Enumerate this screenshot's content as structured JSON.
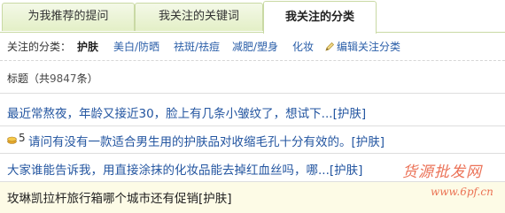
{
  "tabs": [
    {
      "label": "为我推荐的提问"
    },
    {
      "label": "我关注的关键词"
    },
    {
      "label": "我关注的分类"
    }
  ],
  "filter": {
    "label": "关注的分类：",
    "categories": [
      "护肤",
      "美白/防晒",
      "祛斑/祛痘",
      "减肥/塑身",
      "化妆"
    ],
    "active": "护肤",
    "edit_label": "编辑关注分类"
  },
  "summary": {
    "prefix": "标题（共",
    "count": "9847",
    "suffix": "条）"
  },
  "questions": [
    {
      "title": "最近常熬夜，年龄又接近30，脸上有几条小皱纹了，想试下...",
      "tag": "[护肤]"
    },
    {
      "points": "5",
      "title": "请问有没有一款适合男生用的护肤品对收缩毛孔十分有效的。",
      "tag": "[护肤]"
    },
    {
      "title": "大家谁能告诉我，用直接涂抹的化妆品能去掉红血丝吗，哪...",
      "tag": "[护肤]"
    },
    {
      "title": "玫琳凯拉杆旅行箱哪个城市还有促销",
      "tag": "[护肤]"
    }
  ],
  "watermark": {
    "text": "货源批发网",
    "url": "www.6pf.cn"
  },
  "colors": {
    "tab_border": "#c9d9a4",
    "tab_bg": "#e3efc6",
    "link": "#2355a0",
    "highlight_row": "#fdfbe6",
    "watermark": "#e85a3a"
  }
}
